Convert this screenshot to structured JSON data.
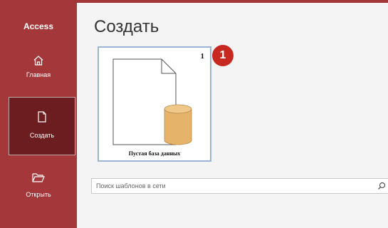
{
  "sidebar": {
    "app_title": "Access",
    "items": [
      {
        "label": "Главная",
        "icon": "home-icon"
      },
      {
        "label": "Создать",
        "icon": "new-document-icon"
      },
      {
        "label": "Открыть",
        "icon": "open-folder-icon"
      }
    ]
  },
  "main": {
    "title": "Создать",
    "template": {
      "label": "Пустая база данных",
      "number": "1",
      "icon": "blank-database-icon"
    },
    "callout": "1",
    "search": {
      "placeholder": "Поиск шаблонов в сети",
      "icon": "search-icon"
    }
  },
  "colors": {
    "sidebar_bg": "#a4373a",
    "selected_bg": "#6b1d1f",
    "callout_bg": "#c72820",
    "tile_border": "#9bb6d4",
    "database_cylinder": "#e6b36a"
  }
}
